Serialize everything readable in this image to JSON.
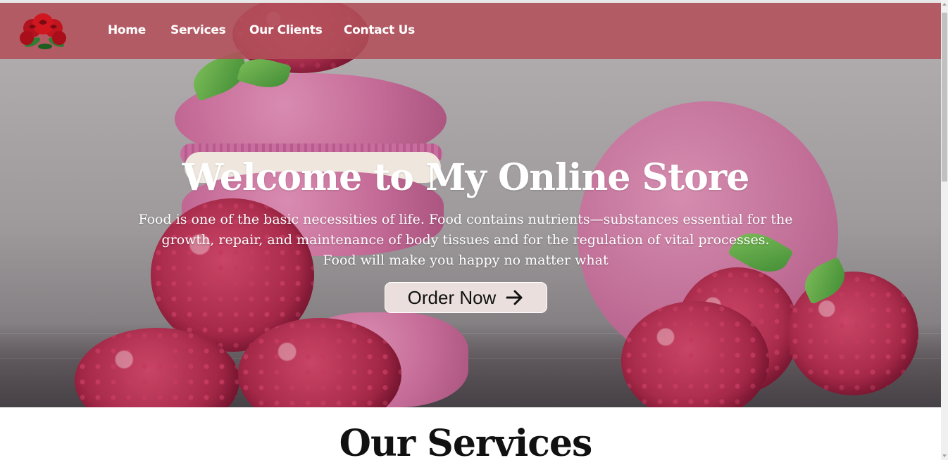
{
  "nav": {
    "links": [
      {
        "label": "Home"
      },
      {
        "label": "Services"
      },
      {
        "label": "Our Clients"
      },
      {
        "label": "Contact Us"
      }
    ],
    "logo_icon": "rose-logo-icon"
  },
  "hero": {
    "title": "Welcome to My Online Store",
    "description_lines": [
      "Food is one of the basic necessities of life. Food contains nutrients—substances essential for the",
      "growth, repair, and maintenance of body tissues and for the regulation of vital processes.",
      "Food will make you happy no matter what"
    ],
    "cta_label": "Order Now",
    "cta_icon": "arrow-right-icon"
  },
  "services": {
    "title": "Our Services"
  },
  "colors": {
    "nav_bg": "#b2505a",
    "button_bg": "#eadfdc",
    "text_light": "#ffffff",
    "text_dark": "#111111"
  }
}
